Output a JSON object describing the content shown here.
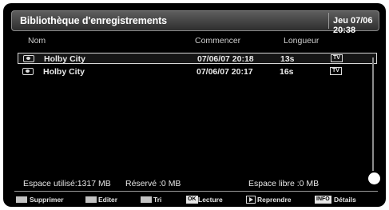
{
  "window": {
    "title": "Bibliothèque d'enregistrements",
    "clock": "Jeu 07/06 20:38"
  },
  "columns": {
    "name": "Nom",
    "start": "Commencer",
    "length": "Longueur"
  },
  "recordings": [
    {
      "title": "Holby City",
      "start": "07/06/07  20:18",
      "length": "13s",
      "badge": "TV",
      "selected": true
    },
    {
      "title": "Holby City",
      "start": "07/06/07  20:17",
      "length": "16s",
      "badge": "TV",
      "selected": false
    }
  ],
  "storage": {
    "used": "Espace utilisé:1317 MB",
    "reserved": "Réservé :0 MB",
    "free": "Espace libre :0 MB"
  },
  "footer": {
    "delete_label": "Supprimer",
    "edit_label": "Editer",
    "sort_label": "Tri",
    "ok_key": "OK",
    "play_label": "Lecture",
    "resume_label": "Reprendre",
    "info_key": "INFO",
    "details_label": "Détails"
  },
  "colors": {
    "background": "#000000",
    "text": "#e6e6e6",
    "selection_border": "#d8d8d8",
    "swatch": "#c4c4c4"
  }
}
